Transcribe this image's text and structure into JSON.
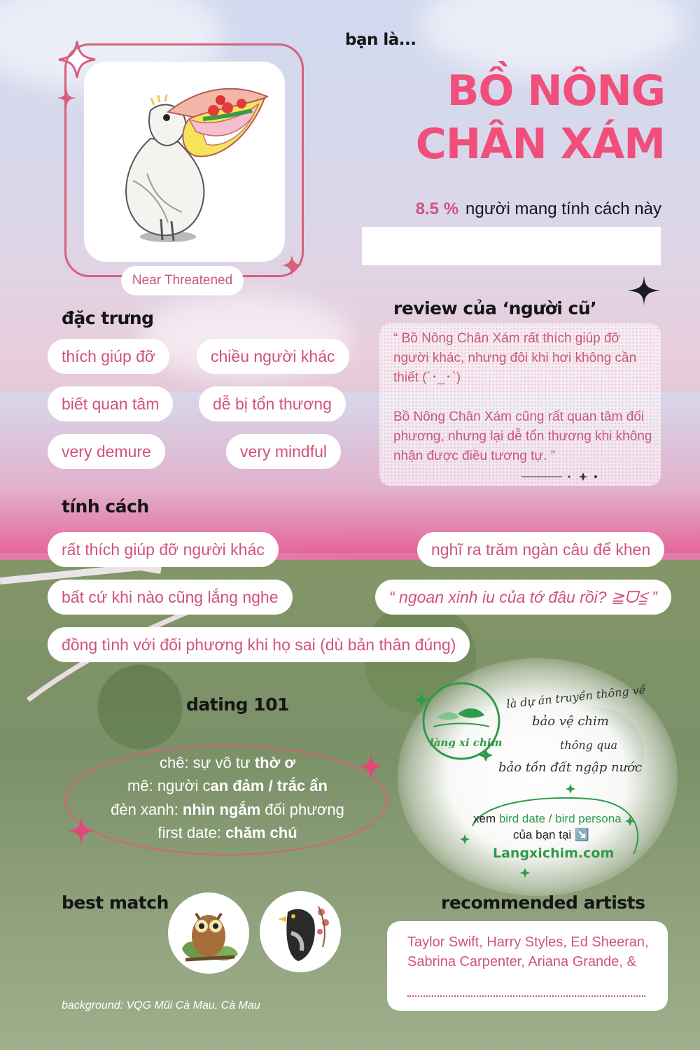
{
  "header": {
    "intro": "bạn là...",
    "title_line1": "BỒ NÔNG",
    "title_line2": "CHÂN XÁM",
    "stat_value": "8.5 %",
    "stat_label": "người mang tính cách này",
    "status": "Near Threatened"
  },
  "traits": {
    "heading": "đặc trưng",
    "items": [
      "thích giúp đỡ",
      "chiều người khác",
      "biết quan tâm",
      "dễ bị tổn thương",
      "very demure",
      "very mindful"
    ]
  },
  "review": {
    "heading": "review của ‘người cũ’",
    "paragraph1": "“  Bồ Nông Chân Xám rất thích giúp đỡ người khác, nhưng đôi khi hơi không cần thiết  (´･_･`)",
    "paragraph2": "Bồ Nông Chân Xám cũng rất quan tâm đối phương, nhưng lại dễ tổn thương khi không nhận được điều tương tự.  ”"
  },
  "personality": {
    "heading": "tính cách",
    "items": [
      "rất thích giúp đỡ người khác",
      "nghĩ ra trăm ngàn câu để khen",
      "bất cứ khi nào cũng lắng nghe",
      "“ ngoan xinh iu của tớ đâu rồi? ≧ᗜ≦ ”",
      "đồng tình với đối phương khi họ sai (dù bản thân đúng)"
    ]
  },
  "dating": {
    "heading": "dating 101",
    "line1_label": "chê: sự vô tư ",
    "line1_bold": "thờ ơ",
    "line2_label": "mê: người c",
    "line2_bold": "an đảm / trắc ẩn",
    "line3_label": "đèn xanh: ",
    "line3_bold": "nhìn ngắm",
    "line3_tail": " đối phương",
    "line4_label": "first date: ",
    "line4_bold": "chăm chú"
  },
  "promo": {
    "logo_text": "làng xi chim",
    "line1": "là dự án truyền thông về",
    "line2": "bảo vệ chim",
    "line3": "thông qua",
    "line4": "bảo tồn đất ngập nước",
    "cta_prefix": "xem ",
    "cta_highlight": "bird date / bird persona",
    "cta_line2": "của bạn tại ↘️",
    "url": "Langxichim.com"
  },
  "best_match": {
    "heading": "best match"
  },
  "artists": {
    "heading": "recommended artists",
    "text": "Taylor Swift, Harry Styles, Ed Sheeran, Sabrina Carpenter, Ariana Grande, &"
  },
  "footer": {
    "background_credit": "background: VQG Mũi Cà Mau, Cà Mau"
  },
  "colors": {
    "accent_pink": "#f04f7c",
    "text_pink": "#d2527c",
    "frame_pink": "#d6607e",
    "green": "#2f9a4a"
  },
  "icons": [
    "sparkle-icon",
    "pelican-illustration",
    "owl-illustration",
    "myna-illustration",
    "bird-logo-icon",
    "arrow-down-right-icon"
  ]
}
